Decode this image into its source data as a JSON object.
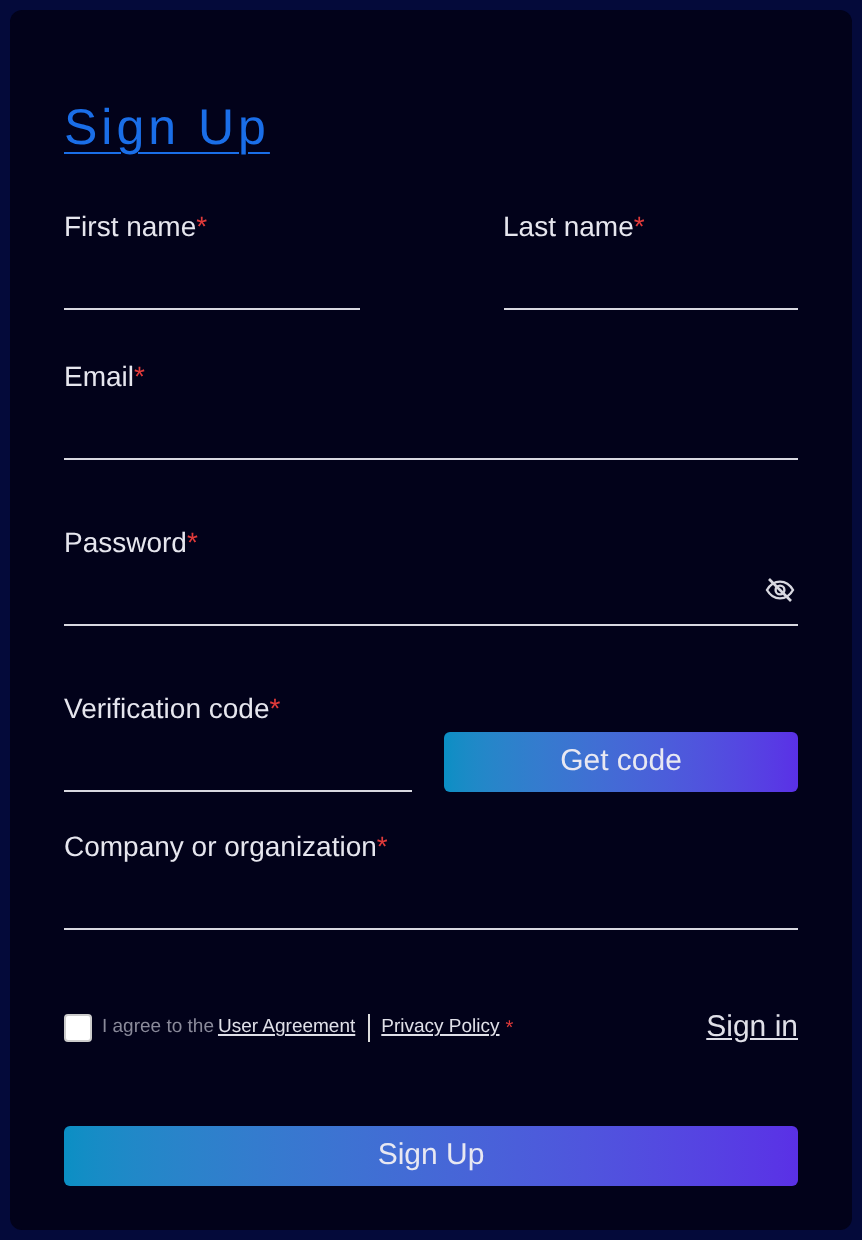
{
  "title": "Sign Up",
  "name_fields": [
    {
      "label": "First name",
      "required_mark": "*"
    },
    {
      "label": "Last name",
      "required_mark": "*"
    }
  ],
  "email": {
    "label": "Email",
    "required_mark": "*"
  },
  "password": {
    "label": "Password",
    "required_mark": "*",
    "masked": true
  },
  "verification": {
    "label": "Verification code",
    "required_mark": "*",
    "button": "Get code"
  },
  "company": {
    "label": "Company or organization",
    "required_mark": "*"
  },
  "agreement": {
    "checked": false,
    "text": "I agree to the",
    "links": [
      "User Agreement",
      "Privacy Policy"
    ],
    "required_mark": "*"
  },
  "sign_in_link": "Sign in",
  "submit": "Sign Up"
}
